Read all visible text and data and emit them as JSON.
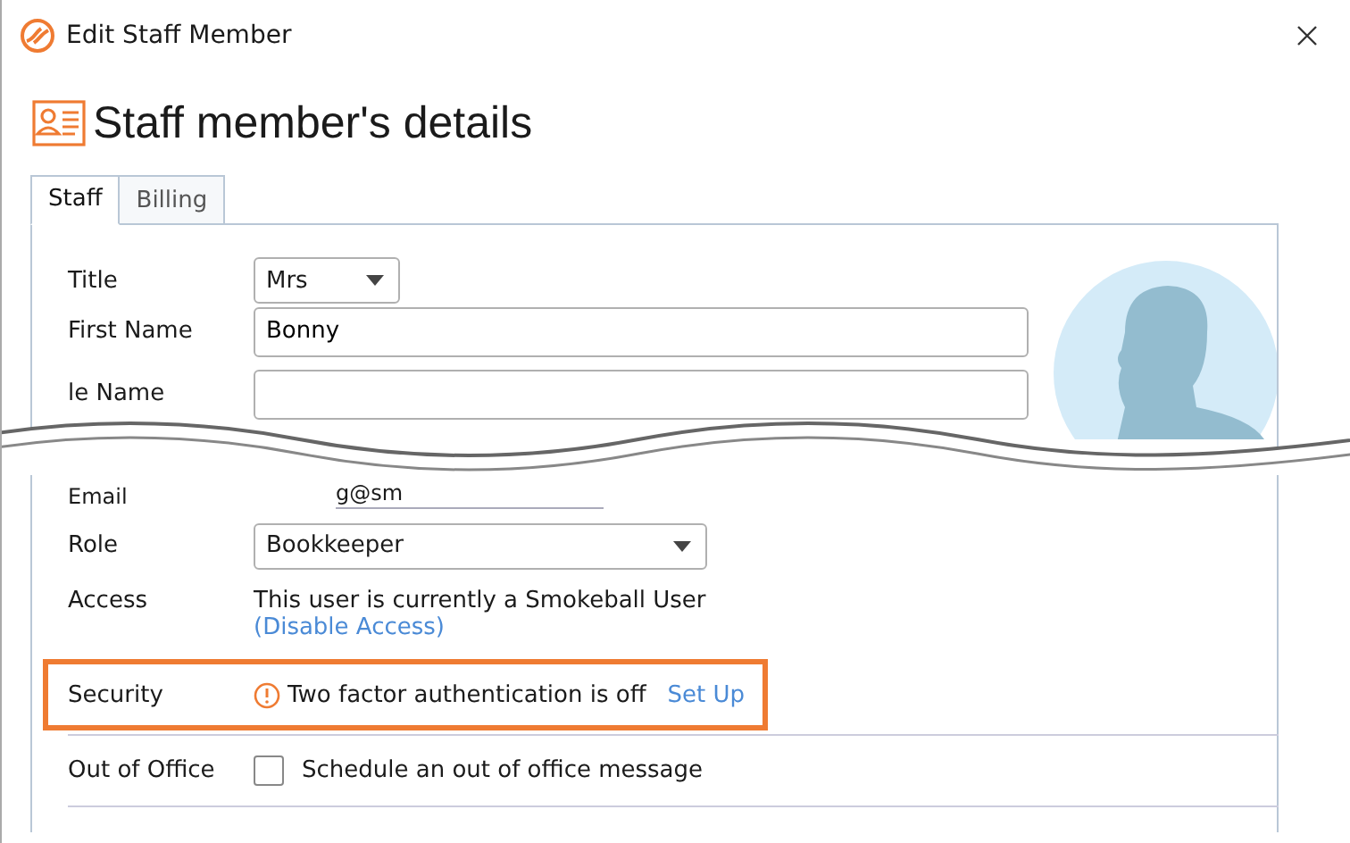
{
  "window": {
    "title": "Edit Staff Member"
  },
  "heading": "Staff member's details",
  "tabs": [
    {
      "label": "Staff",
      "selected": true
    },
    {
      "label": "Billing",
      "selected": false
    }
  ],
  "upper_fields": [
    {
      "kind": "dropdown",
      "label": "Title",
      "value": "Mrs"
    },
    {
      "kind": "text",
      "label": "First Name",
      "value": "Bonny"
    },
    {
      "kind": "text",
      "label": "le Name"
    }
  ],
  "lower_fields": [
    {
      "kind": "fragment",
      "label": "Email",
      "value": "g@sm"
    },
    {
      "kind": "dropdown",
      "label": "Role",
      "value": "Bookkeeper"
    },
    {
      "kind": "static",
      "label": "Access",
      "value": "This user is currently a Smokeball User",
      "link": "(Disable Access)"
    },
    {
      "kind": "security",
      "label": "Security",
      "value": "Two factor authentication is off",
      "link": "Set Up",
      "highlighted": true
    },
    {
      "kind": "checkbox",
      "label": "Out of Office",
      "value": "Schedule an out of office message",
      "checked": false
    }
  ]
}
